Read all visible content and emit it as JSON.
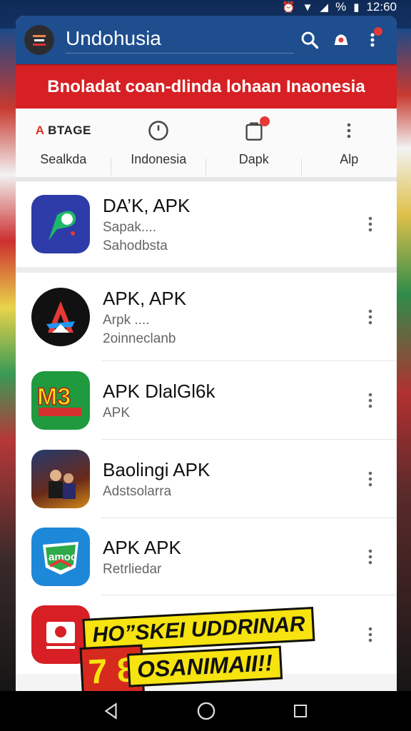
{
  "status_bar": {
    "time": "12:60",
    "battery": "%"
  },
  "header": {
    "title": "Undohusia"
  },
  "banner": {
    "text": "Bnoladat coan-dlinda lohaan Inaonesia"
  },
  "tabs": [
    {
      "icon": "brand-mark",
      "mark_red": "A",
      "mark_dark": " BTAGE",
      "label": "Sealkda"
    },
    {
      "icon": "clock-icon",
      "label": "Indonesia"
    },
    {
      "icon": "bag-icon",
      "label": "Dapk",
      "badge": true
    },
    {
      "icon": "more-vert-icon",
      "label": "Alp"
    }
  ],
  "list": [
    {
      "title": "DA’K, APK",
      "subtitle": "Sapak....",
      "subtitle2": "Sahodbsta",
      "icon": "play-leaf-icon",
      "icon_bg": "#2d3ca8"
    },
    {
      "title": "APK, APK",
      "subtitle": "Arpk ....",
      "subtitle2": "2oinneclanb",
      "icon": "a-letter-icon",
      "icon_bg": "#111111"
    },
    {
      "title": "APK DlalGl6k",
      "subtitle": "APK",
      "subtitle2": "",
      "icon": "m3-icon",
      "icon_bg": "#1f9a3f"
    },
    {
      "title": "Baolingi APK",
      "subtitle": "Adstsolarra",
      "subtitle2": "",
      "icon": "movie-poster-icon",
      "icon_bg": "#233a6e"
    },
    {
      "title": "APK APK",
      "subtitle": "Retrliedar",
      "subtitle2": "",
      "icon": "shield-badge-icon",
      "icon_bg": "#1e88d8"
    },
    {
      "title": "",
      "subtitle": "",
      "subtitle2": "",
      "icon": "camera-box-icon",
      "icon_bg": "#d81f26"
    }
  ],
  "promo": {
    "top": "HO”SKEI UDDRINAR",
    "bottom": "OSANIMAII!!",
    "number": "7 8"
  }
}
